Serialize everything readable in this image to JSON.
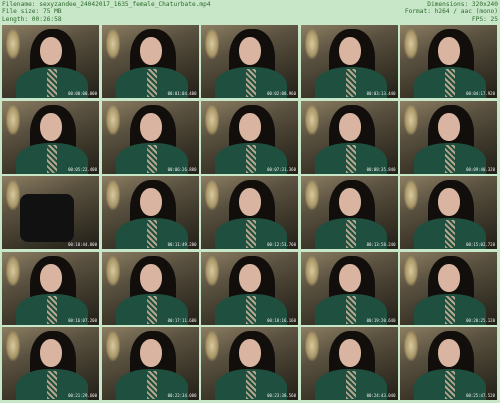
{
  "header": {
    "filename": "Filename: sexyzandee_24042017_1635_female_Chaturbate.mp4",
    "filesize": "File size: 75 MB",
    "length": "Length: 00:26:58",
    "dimensions": "Dimensions: 320x240",
    "format": "Format: h264 / aac (mono)",
    "fps": "FPS: 25"
  },
  "thumbnails": [
    {
      "timestamp": "00:00:00.000"
    },
    {
      "timestamp": "00:01:04.480"
    },
    {
      "timestamp": "00:02:08.960"
    },
    {
      "timestamp": "00:03:13.440"
    },
    {
      "timestamp": "00:04:17.920"
    },
    {
      "timestamp": "00:05:22.400"
    },
    {
      "timestamp": "00:06:26.880"
    },
    {
      "timestamp": "00:07:31.360"
    },
    {
      "timestamp": "00:08:35.840"
    },
    {
      "timestamp": "00:09:40.320"
    },
    {
      "timestamp": "00:10:44.800"
    },
    {
      "timestamp": "00:11:49.280"
    },
    {
      "timestamp": "00:12:53.760"
    },
    {
      "timestamp": "00:13:58.240"
    },
    {
      "timestamp": "00:15:02.720"
    },
    {
      "timestamp": "00:16:07.200"
    },
    {
      "timestamp": "00:17:11.680"
    },
    {
      "timestamp": "00:18:16.160"
    },
    {
      "timestamp": "00:19:20.640"
    },
    {
      "timestamp": "00:20:25.120"
    },
    {
      "timestamp": "00:21:29.600"
    },
    {
      "timestamp": "00:22:34.080"
    },
    {
      "timestamp": "00:23:38.560"
    },
    {
      "timestamp": "00:24:43.040"
    },
    {
      "timestamp": "00:25:47.520"
    }
  ]
}
